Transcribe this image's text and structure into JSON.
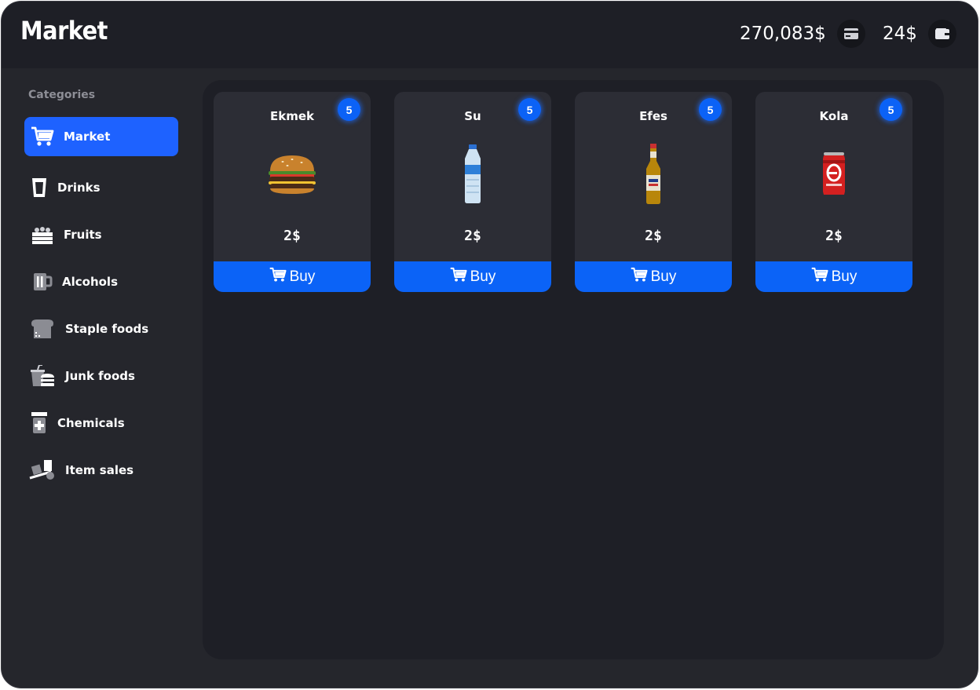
{
  "header": {
    "title": "Market",
    "bank_balance": "270,083$",
    "cash_balance": "24$",
    "bank_icon": "credit-card-icon",
    "cash_icon": "wallet-icon"
  },
  "sidebar": {
    "heading": "Categories",
    "items": [
      {
        "label": "Market",
        "icon": "cart-icon",
        "active": true
      },
      {
        "label": "Drinks",
        "icon": "cup-icon"
      },
      {
        "label": "Fruits",
        "icon": "fruit-crate-icon"
      },
      {
        "label": "Alcohols",
        "icon": "beer-mug-icon"
      },
      {
        "label": "Staple foods",
        "icon": "bread-icon"
      },
      {
        "label": "Junk foods",
        "icon": "fastfood-icon"
      },
      {
        "label": "Chemicals",
        "icon": "medicine-bottle-icon"
      },
      {
        "label": "Item sales",
        "icon": "hand-truck-icon"
      }
    ]
  },
  "products": [
    {
      "name": "Ekmek",
      "stock": "5",
      "price": "2$",
      "image": "burger-image",
      "buy_label": "Buy"
    },
    {
      "name": "Su",
      "stock": "5",
      "price": "2$",
      "image": "water-bottle-image",
      "buy_label": "Buy"
    },
    {
      "name": "Efes",
      "stock": "5",
      "price": "2$",
      "image": "beer-bottle-image",
      "buy_label": "Buy"
    },
    {
      "name": "Kola",
      "stock": "5",
      "price": "2$",
      "image": "cola-can-image",
      "buy_label": "Buy"
    }
  ],
  "colors": {
    "accent": "#1e62ff",
    "buy_button": "#0b63f7",
    "background": "#25262c",
    "panel": "#1e1f26",
    "card": "#2c2d35"
  }
}
